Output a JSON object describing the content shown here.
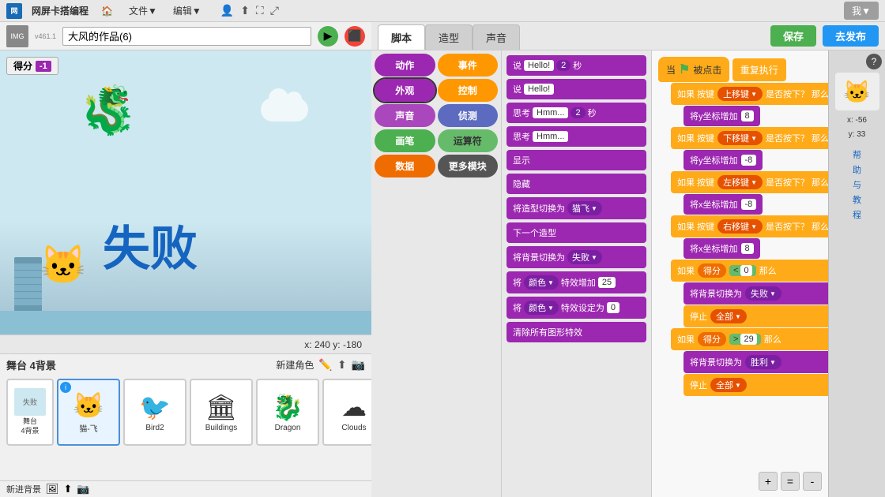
{
  "app": {
    "name": "网屏卡搭编程",
    "version": "v461.1",
    "menu_items": [
      "文件▼",
      "编辑▼"
    ],
    "me_label": "我▼"
  },
  "toolbar": {
    "save_label": "保存",
    "publish_label": "去发布"
  },
  "project": {
    "title": "大风的作品(6)",
    "score_label": "得分",
    "score_value": "-1"
  },
  "stage": {
    "coords": "x: 240  y: -180"
  },
  "tabs": {
    "script": "脚本",
    "costume": "造型",
    "sound": "声音"
  },
  "categories": [
    {
      "id": "motion",
      "label": "动作",
      "color": "#9c27b0"
    },
    {
      "id": "events",
      "label": "事件",
      "color": "#ff9800"
    },
    {
      "id": "looks",
      "label": "外观",
      "color": "#9c27b0",
      "active": true
    },
    {
      "id": "control",
      "label": "控制",
      "color": "#ff9800"
    },
    {
      "id": "sound",
      "label": "声音",
      "color": "#ab47bc"
    },
    {
      "id": "sensing",
      "label": "侦测",
      "color": "#5c6bc0"
    },
    {
      "id": "pen",
      "label": "画笔",
      "color": "#4caf50"
    },
    {
      "id": "operators",
      "label": "运算符",
      "color": "#66bb6a"
    },
    {
      "id": "data",
      "label": "数据",
      "color": "#ef6c00"
    },
    {
      "id": "more",
      "label": "更多模块",
      "color": "#555"
    }
  ],
  "palette_blocks": [
    {
      "label": "说 Hello! 2 秒",
      "type": "purple"
    },
    {
      "label": "说 Hello!",
      "type": "purple"
    },
    {
      "label": "思考 Hmm... 2 秒",
      "type": "purple"
    },
    {
      "label": "思考 Hmm...",
      "type": "purple"
    },
    {
      "label": "显示",
      "type": "purple"
    },
    {
      "label": "隐藏",
      "type": "purple"
    },
    {
      "label": "将造型切换为 猫飞▼",
      "type": "purple"
    },
    {
      "label": "下一个造型",
      "type": "purple"
    },
    {
      "label": "将背景切换为 失败▼",
      "type": "purple"
    },
    {
      "label": "将 颜色▼ 特效增加 25",
      "type": "purple"
    },
    {
      "label": "将 颜色▼ 特效设定为 0",
      "type": "purple"
    },
    {
      "label": "清除所有图形特效",
      "type": "purple"
    }
  ],
  "sprites": [
    {
      "name": "失败",
      "label": "舞台\n4背景",
      "is_stage": true
    },
    {
      "name": "猫-飞",
      "emoji": "🐱",
      "selected": true
    },
    {
      "name": "Bird2",
      "emoji": "🐦"
    },
    {
      "name": "Buildings",
      "emoji": "🏛"
    },
    {
      "name": "Dragon",
      "emoji": "🐉"
    },
    {
      "name": "Clouds",
      "emoji": "☁"
    }
  ],
  "script": {
    "when_flag": "当 🚩 被点击",
    "repeat": "重复执行",
    "if_up": "如果 按键 上移键 是否按下？那么",
    "move_y_up": "将y坐标增加 8",
    "if_down": "如果 按键 下移键 是否按下？那么",
    "move_y_down": "将y坐标增加 -8",
    "if_left": "如果 按键 左移键 是否按下？那么",
    "move_x_left": "将x坐标增加 -8",
    "if_right": "如果 按键 右移键 是否按下？那么",
    "move_x_right": "将x坐标增加 8",
    "if_score_low": "如果 得分 < 0 那么",
    "switch_bg_lose": "将背景切换为 失败▼",
    "stop_all_lose": "停止 全部▼",
    "if_score_high": "如果 得分 > 29 那么",
    "switch_bg_win": "将背景切换为 胜利▼",
    "stop_all_win": "停止 全部▼"
  },
  "help": {
    "coords_x": "x: -56",
    "coords_y": "y: 33",
    "links": [
      "帮",
      "助",
      "与",
      "教",
      "程"
    ]
  },
  "zoom": {
    "zoom_in": "+",
    "reset": "=",
    "zoom_out": "-"
  }
}
